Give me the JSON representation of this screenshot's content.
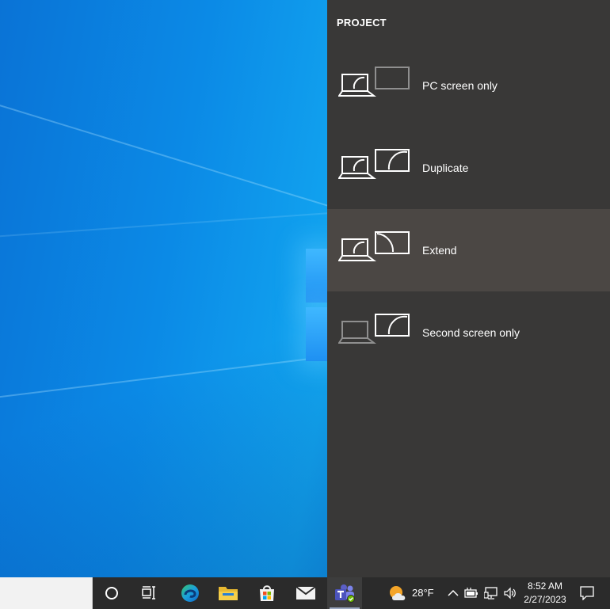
{
  "panel": {
    "title": "PROJECT",
    "options": [
      {
        "label": "PC screen only",
        "icon": "pc-screen-only-icon",
        "selected": false
      },
      {
        "label": "Duplicate",
        "icon": "duplicate-icon",
        "selected": false
      },
      {
        "label": "Extend",
        "icon": "extend-icon",
        "selected": true
      },
      {
        "label": "Second screen only",
        "icon": "second-screen-only-icon",
        "selected": false
      }
    ]
  },
  "taskbar": {
    "weather": {
      "temperature": "28°F",
      "icon": "partly-cloudy-icon"
    },
    "clock": {
      "time": "8:52 AM",
      "date": "2/27/2023"
    },
    "pinned_icons": [
      "cortana-icon",
      "task-view-icon",
      "edge-icon",
      "file-explorer-icon",
      "microsoft-store-icon",
      "mail-icon",
      "teams-icon"
    ]
  },
  "colors": {
    "panel_bg": "#393837",
    "selected_bg": "#4b4744",
    "taskbar_bg": "#2b2b2b"
  }
}
